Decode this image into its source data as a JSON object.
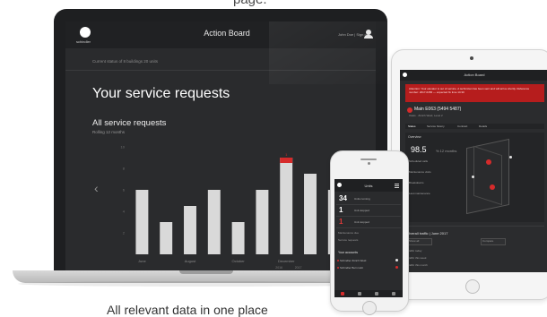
{
  "caption_top": "page.",
  "caption_bottom": "All relevant data in one place",
  "laptop": {
    "app_title": "Action Board",
    "logo_text": "schindler",
    "user_name": "John Doe | Sign out",
    "subheader": "Current status of 8 buildings 20 units",
    "page_title": "Your service requests",
    "chart_data": {
      "type": "bar",
      "title": "All service requests",
      "subtitle": "Rolling 12 months",
      "categories": [
        "June",
        "July",
        "August",
        "September",
        "October",
        "November",
        "December",
        "January",
        "February",
        "March"
      ],
      "tick_labels": [
        "June",
        "August",
        "October",
        "December",
        "March"
      ],
      "year_labels": [
        "2016",
        "2017"
      ],
      "values": [
        6,
        3,
        4.5,
        6,
        3,
        6,
        9,
        7.5,
        6,
        3
      ],
      "highlight_index": 6,
      "highlight_value": 1,
      "ylim": [
        0,
        10
      ],
      "y_ticks": [
        "10",
        "8",
        "6",
        "4",
        "2"
      ],
      "accent": "#d62b2b",
      "bar_color": "#d9d9d9"
    }
  },
  "tablet": {
    "app_title": "Action Board",
    "alert_text": "Attention: Your elevator is out of service. A technician has been sent and will arrive shortly. Reference number: 2017-0456 — expected fix time 14:30",
    "machine_title": "Main E063 (5494 5487)",
    "machine_sub": "Oasis · Zürich Weid, Level 2",
    "tabs": [
      "Status",
      "Service history",
      "Contract",
      "Details"
    ],
    "overview_label": "Overview",
    "availability_value": "98.5",
    "availability_unit": "% 12 months",
    "stats": [
      "Scheduled calls",
      "Maintenance visits",
      "Breakdowns",
      "Last maintenance"
    ],
    "bottom_title": "Overall traffic | June 2017",
    "buttons": [
      "Show all",
      "Compare"
    ],
    "list": [
      "Traffic today",
      "Traffic this week",
      "Traffic this month"
    ]
  },
  "phone": {
    "app_title": "Units",
    "rows": [
      {
        "num": "34",
        "label": "Units running",
        "red": false
      },
      {
        "num": "1",
        "label": "Unit stopped",
        "red": false
      },
      {
        "num": "1",
        "label": "Unit stopped",
        "red": true
      }
    ],
    "sections": [
      "Maintenance due",
      "Service requests"
    ],
    "favorites_title": "Your accounts",
    "favorites": [
      "Schindler Zürich Weid",
      "Schindler Bern Hub"
    ]
  }
}
